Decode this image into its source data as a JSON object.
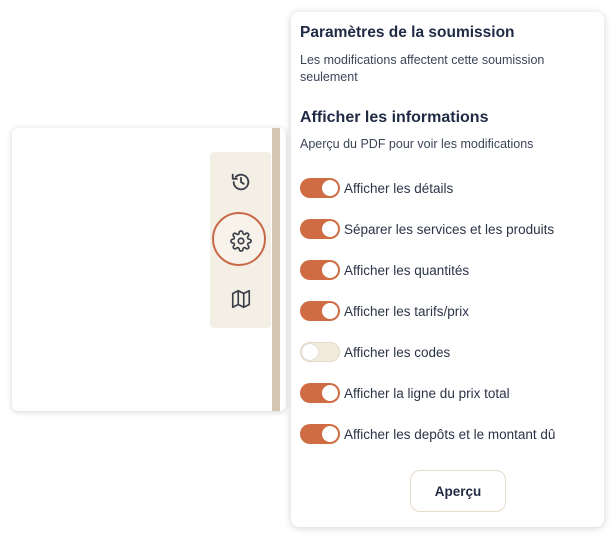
{
  "sidebar": {
    "tools": [
      {
        "icon": "history-icon"
      },
      {
        "icon": "gear-icon",
        "active": true
      },
      {
        "icon": "map-icon"
      }
    ]
  },
  "panel": {
    "title": "Paramètres de la soumission",
    "subtitle": "Les modifications affectent cette soumission seulement",
    "section_title": "Afficher les informations",
    "section_subtitle": "Aperçu du PDF pour voir les modifications",
    "toggles": [
      {
        "label": "Afficher les détails",
        "on": true
      },
      {
        "label": "Séparer les services et les produits",
        "on": true
      },
      {
        "label": "Afficher les quantités",
        "on": true
      },
      {
        "label": "Afficher les tarifs/prix",
        "on": true
      },
      {
        "label": "Afficher les codes",
        "on": false
      },
      {
        "label": "Afficher la ligne du prix total",
        "on": true
      },
      {
        "label": "Afficher les depôts et le montant dû",
        "on": true
      }
    ],
    "preview_button": "Aperçu"
  },
  "colors": {
    "accent": "#cf6c44",
    "toggle_off": "#f2ebde",
    "rail": "#f4efe5"
  }
}
